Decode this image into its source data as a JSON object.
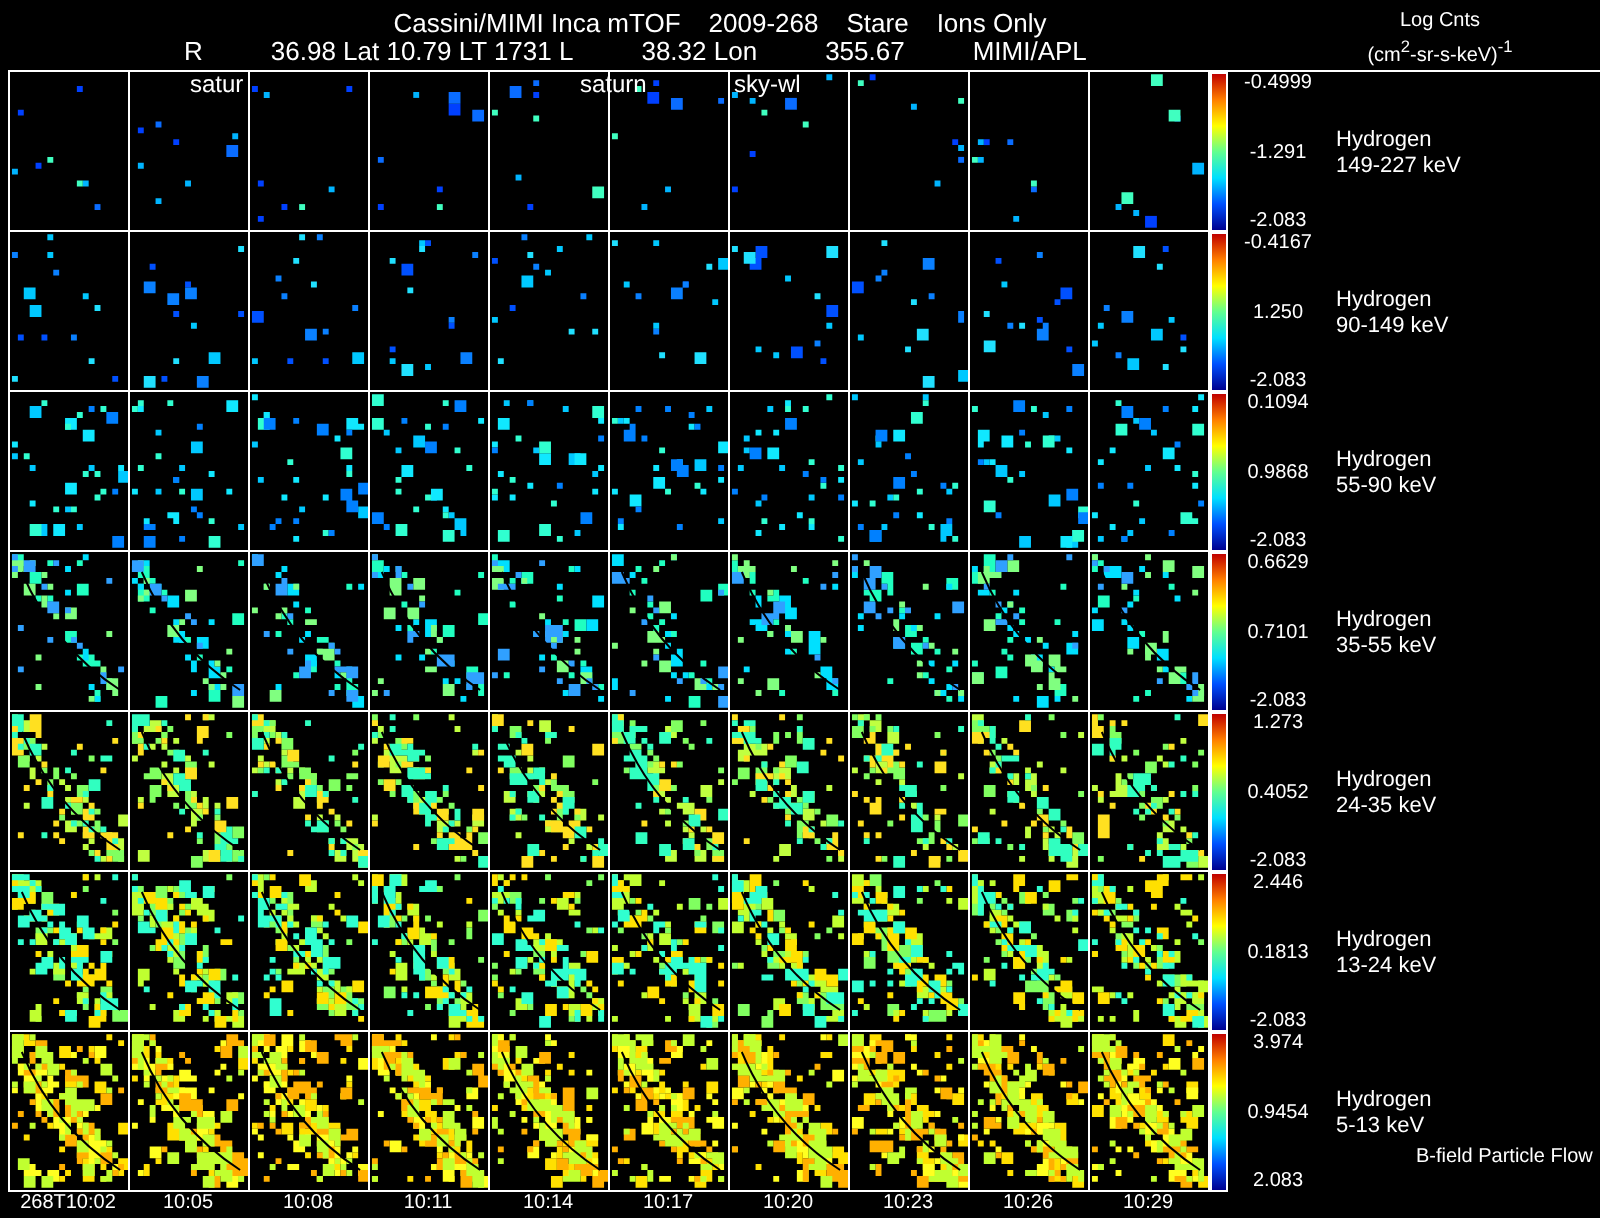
{
  "title": [
    "Cassini/MIMI Inca mTOF",
    "2009-268",
    "Stare",
    "Ions Only"
  ],
  "info_line": [
    "R",
    "36.98 Lat 10.79 LT 1731 L",
    "38.32 Lon",
    "355.67",
    "MIMI/APL"
  ],
  "overlay_labels": [
    "satur",
    "saturn",
    "sky-wl"
  ],
  "units": {
    "title": "Log Cnts",
    "unit": "(cm$^{2}$-sr-s-keV)$^{-1}$"
  },
  "rows": [
    {
      "species": "Hydrogen",
      "energy": "149-227 keV",
      "max": "-0.4999",
      "mid": "-1.291",
      "min": "-2.083"
    },
    {
      "species": "Hydrogen",
      "energy": "90-149 keV",
      "max": "-0.4167",
      "mid": "1.250",
      "min": "-2.083"
    },
    {
      "species": "Hydrogen",
      "energy": "55-90 keV",
      "max": "0.1094",
      "mid": "0.9868",
      "min": "-2.083"
    },
    {
      "species": "Hydrogen",
      "energy": "35-55 keV",
      "max": "0.6629",
      "mid": "0.7101",
      "min": "-2.083"
    },
    {
      "species": "Hydrogen",
      "energy": "24-35 keV",
      "max": "1.273",
      "mid": "0.4052",
      "min": "-2.083"
    },
    {
      "species": "Hydrogen",
      "energy": "13-24 keV",
      "max": "2.446",
      "mid": "0.1813",
      "min": "-2.083"
    },
    {
      "species": "Hydrogen",
      "energy": "5-13 keV",
      "max": "3.974",
      "mid": "0.9454",
      "min": "2.083"
    }
  ],
  "footer_note": "B-field Particle Flow",
  "times": [
    "268T10:02",
    "10:05",
    "10:08",
    "10:11",
    "10:14",
    "10:17",
    "10:20",
    "10:23",
    "10:26",
    "10:29"
  ]
}
